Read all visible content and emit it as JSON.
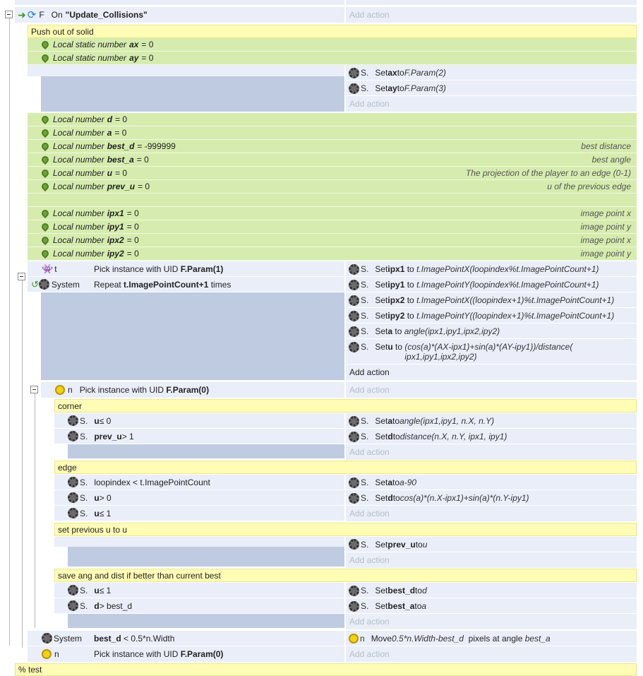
{
  "ev_header": {
    "obj": "F",
    "prefix": "On",
    "trigger": "\"Update_Collisions\"",
    "add_action": "Add action"
  },
  "comment_push": "Push out of solid",
  "static_vars": [
    {
      "kw": "Local static number",
      "name": "ax",
      "val": "= 0"
    },
    {
      "kw": "Local static number",
      "name": "ay",
      "val": "= 0"
    }
  ],
  "sub_actions_1": [
    {
      "text": "Set ",
      "name": "ax",
      "to": " to ",
      "expr": "F.Param(2)"
    },
    {
      "text": "Set ",
      "name": "ay",
      "to": " to ",
      "expr": "F.Param(3)"
    }
  ],
  "add_action": "Add action",
  "local_vars": [
    {
      "kw": "Local number",
      "name": "d",
      "val": "= 0",
      "comment": ""
    },
    {
      "kw": "Local number",
      "name": "a",
      "val": "= 0",
      "comment": ""
    },
    {
      "kw": "Local number",
      "name": "best_d",
      "val": "= -999999",
      "comment": "best distance"
    },
    {
      "kw": "Local number",
      "name": "best_a",
      "val": "= 0",
      "comment": "best angle"
    },
    {
      "kw": "Local number",
      "name": "u",
      "val": "= 0",
      "comment": "The projection of the player to an edge (0-1)"
    },
    {
      "kw": "Local number",
      "name": "prev_u",
      "val": "= 0",
      "comment": "u of the previous edge"
    }
  ],
  "local_vars2": [
    {
      "kw": "Local number",
      "name": "ipx1",
      "val": "= 0",
      "comment": "image point x"
    },
    {
      "kw": "Local number",
      "name": "ipy1",
      "val": "= 0",
      "comment": "image point y"
    },
    {
      "kw": "Local number",
      "name": "ipx2",
      "val": "= 0",
      "comment": "image point x"
    },
    {
      "kw": "Local number",
      "name": "ipy2",
      "val": "= 0",
      "comment": "image point y"
    }
  ],
  "loop_event": {
    "cond1_obj": "t",
    "cond1_text": "Pick instance with UID ",
    "cond1_param": "F.Param(1)",
    "cond2_obj": "System",
    "cond2_text": "Repeat ",
    "cond2_param": "t.ImagePointCount+1",
    "cond2_tail": " times",
    "actions": [
      {
        "name": "ipx1",
        "expr": "t.ImagePointX(loopindex%t.ImagePointCount+1)"
      },
      {
        "name": "ipy1",
        "expr": "t.ImagePointY(loopindex%t.ImagePointCount+1)"
      },
      {
        "name": "ipx2",
        "expr": "t.ImagePointX((loopindex+1)%t.ImagePointCount+1)"
      },
      {
        "name": "ipy2",
        "expr": "t.ImagePointY((loopindex+1)%t.ImagePointCount+1)"
      },
      {
        "name": "a",
        "expr": "angle(ipx1,ipy1,ipx2,ipy2)"
      },
      {
        "name": "u",
        "expr": "(cos(a)*(AX-ipx1)+sin(a)*(AY-ipy1))/distance(",
        "expr2": "ipx1,ipy1,ipx2,ipy2)"
      }
    ],
    "set": "Set ",
    "to": " to ",
    "add_action": "Add action"
  },
  "pick_n": {
    "obj": "n",
    "text": "Pick instance with UID ",
    "param": "F.Param(0)"
  },
  "comment_corner": "corner",
  "corner_conds": [
    {
      "obj": "S.",
      "name": "u",
      "rest": " ≤ 0"
    },
    {
      "obj": "S.",
      "name": "prev_u",
      "rest": " > 1"
    }
  ],
  "corner_actions": [
    {
      "name": "a",
      "expr": "angle(ipx1,ipy1, n.X, n.Y)"
    },
    {
      "name": "d",
      "expr": "distance(n.X, n.Y, ipx1, ipy1)"
    }
  ],
  "comment_edge": "edge",
  "edge_conds": [
    {
      "obj": "S.",
      "name": "",
      "rest": "loopindex < t.ImagePointCount"
    },
    {
      "obj": "S.",
      "name": "u",
      "rest": " > 0"
    },
    {
      "obj": "S.",
      "name": "u",
      "rest": " ≤ 1"
    }
  ],
  "edge_actions": [
    {
      "name": "a",
      "expr": "a-90"
    },
    {
      "name": "d",
      "expr": "cos(a)*(n.X-ipx1)+sin(a)*(n.Y-ipy1)"
    }
  ],
  "comment_prev": "set previous u to u",
  "prev_action": {
    "name": "prev_u",
    "expr": "u"
  },
  "comment_save": "save ang and dist if better than current best",
  "save_conds": [
    {
      "obj": "S.",
      "name": "u",
      "rest": " ≤ 1"
    },
    {
      "obj": "S.",
      "name": "d",
      "rest": " > best_d"
    }
  ],
  "save_actions": [
    {
      "name": "best_d",
      "expr": "d"
    },
    {
      "name": "best_a",
      "expr": "a"
    }
  ],
  "final_event": {
    "cond1_obj": "System",
    "cond1_name": "best_d",
    "cond1_rest": " < 0.5*n.Width",
    "cond2_obj": "n",
    "cond2_text": "Pick instance with UID ",
    "cond2_param": "F.Param(0)",
    "act_obj": "n",
    "act_move": "Move ",
    "act_expr": "0.5*n.Width-best_d",
    "act_mid": "  pixels at angle ",
    "act_expr2": "best_a"
  },
  "comment_test": "% test",
  "s_label": "S."
}
